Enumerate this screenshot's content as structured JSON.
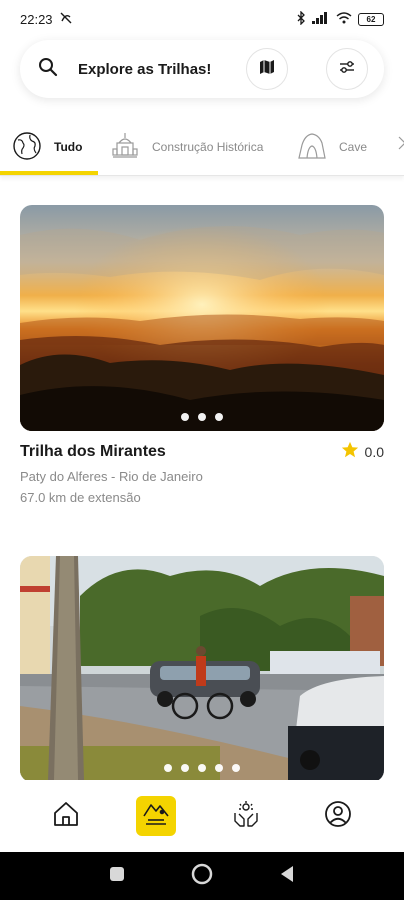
{
  "status_bar": {
    "time": "22:23",
    "battery": "62"
  },
  "search": {
    "label": "Explore as Trilhas!"
  },
  "categories": [
    {
      "label": "Tudo",
      "icon": "globe-icon",
      "active": true
    },
    {
      "label": "Construção Histórica",
      "icon": "historic-building-icon",
      "active": false
    },
    {
      "label": "Cave",
      "icon": "cave-icon",
      "active": false
    }
  ],
  "trails": [
    {
      "title": "Trilha dos Mirantes",
      "rating": "0.0",
      "location": "Paty do Alferes - Rio de Janeiro",
      "distance": "67.0 km de extensão",
      "image": "sunset-mountain-photo",
      "dot_count": 3
    },
    {
      "image": "street-cyclist-photo",
      "dot_count": 5
    }
  ],
  "bottom_nav": [
    {
      "name": "home",
      "icon": "home-icon",
      "active": false
    },
    {
      "name": "trails",
      "icon": "trail-map-icon",
      "active": true
    },
    {
      "name": "community",
      "icon": "hands-icon",
      "active": false
    },
    {
      "name": "profile",
      "icon": "user-icon",
      "active": false
    }
  ],
  "colors": {
    "accent": "#f4d400",
    "text": "#1a1a1a",
    "muted": "#8a8a8a",
    "star": "#f4c400"
  }
}
